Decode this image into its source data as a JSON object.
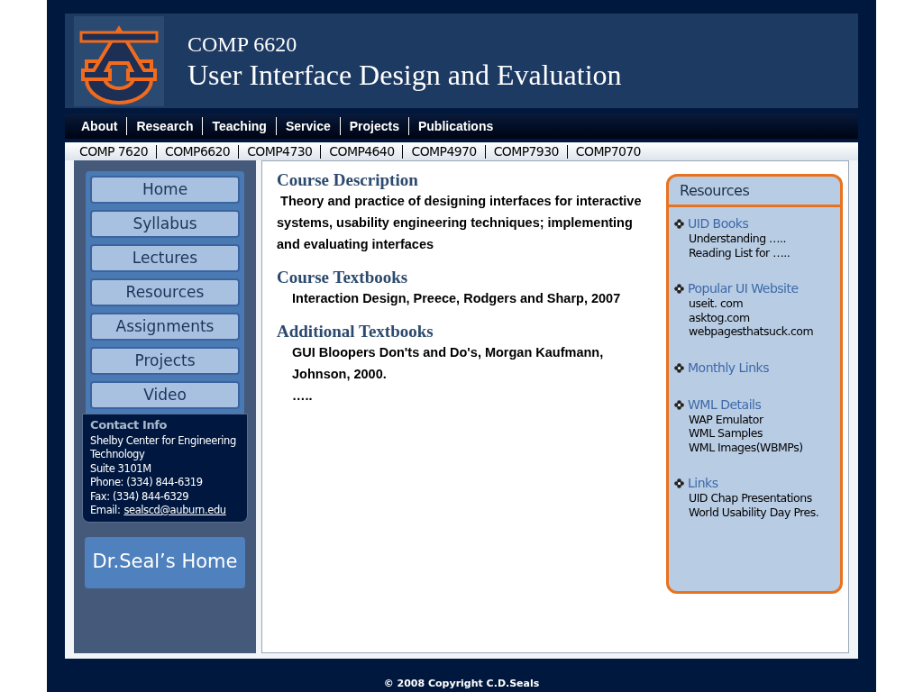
{
  "header": {
    "course_code": "COMP 6620",
    "course_title": "User Interface Design and Evaluation"
  },
  "nav": [
    "About",
    "Research",
    "Teaching",
    "Service",
    "Projects",
    "Publications"
  ],
  "course_links": [
    "COMP 7620",
    "COMP6620",
    "COMP4730",
    "COMP4640",
    "COMP4970",
    "COMP7930",
    "COMP7070"
  ],
  "sidebar": {
    "items": [
      "Home",
      "Syllabus",
      "Lectures",
      "Resources",
      "Assignments",
      "Projects",
      "Video"
    ],
    "contact": {
      "title": "Contact Info",
      "lines": [
        "Shelby Center for Engineering Technology",
        "Suite 3101M",
        "Phone: (334) 844-6319",
        "Fax: (334) 844-6329"
      ],
      "email_label": "Email:",
      "email": "sealscd@auburn.edu"
    },
    "home_button": "Dr.Seal’s Home"
  },
  "content": {
    "sections": [
      {
        "heading": "Course Description",
        "lines": [
          " Theory and practice of designing interfaces for interactive systems, usability engineering techniques; implementing and evaluating interfaces"
        ],
        "indented": false
      },
      {
        "heading": "Course Textbooks",
        "lines": [
          "Interaction Design, Preece, Rodgers and Sharp, 2007"
        ],
        "indented": true
      },
      {
        "heading": "Additional Textbooks",
        "lines": [
          "GUI Bloopers Don'ts and Do's, Morgan Kaufmann, Johnson, 2000.",
          "….."
        ],
        "indented": true
      }
    ]
  },
  "resources": {
    "title": "Resources",
    "groups": [
      {
        "title": "UID Books",
        "links": [
          "Understanding …..",
          "Reading List for ….."
        ]
      },
      {
        "title": "Popular UI Website",
        "links": [
          "useit. com",
          "asktog.com",
          "webpagesthatsuck.com"
        ]
      },
      {
        "title": "Monthly Links"
      },
      {
        "title": "WML Details",
        "links": [
          "WAP Emulator",
          "WML Samples",
          "WML Images(WBMPs)"
        ]
      },
      {
        "title": "Links",
        "links": [
          "UID Chap Presentations",
          "World Usability Day Pres."
        ]
      }
    ]
  },
  "footer": "© 2008 Copyright C.D.Seals"
}
